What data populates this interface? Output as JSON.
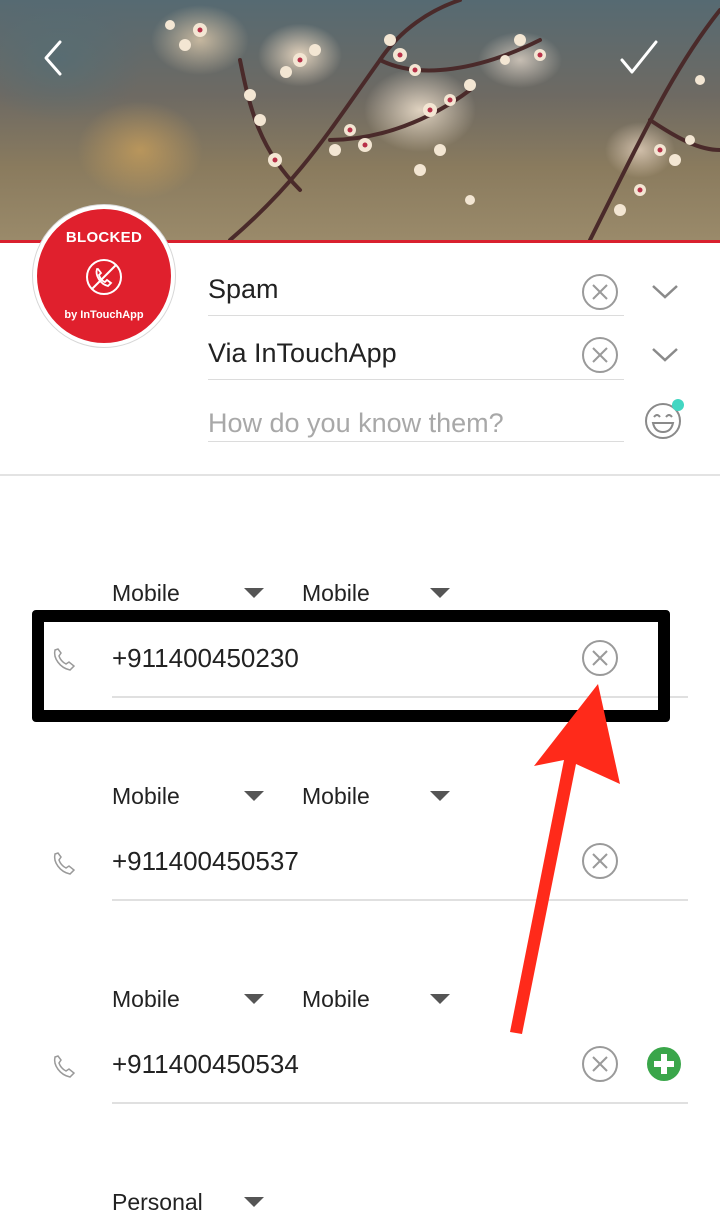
{
  "header": {
    "back_icon": "chevron-left-icon",
    "confirm_icon": "checkmark-icon"
  },
  "avatar": {
    "badge_text": "BLOCKED",
    "brand_text": "by InTouchApp",
    "accent_color": "#e0202d"
  },
  "fields": [
    {
      "value": "Spam",
      "icon": "clear-icon",
      "has_dropdown": true
    },
    {
      "value": "Via InTouchApp",
      "icon": "clear-icon",
      "has_dropdown": true
    }
  ],
  "how_know": {
    "placeholder": "How do you know them?",
    "icon": "emoji-icon"
  },
  "phones": [
    {
      "type1": "Mobile",
      "type2": "Mobile",
      "number": "+911400450230",
      "highlighted": true
    },
    {
      "type1": "Mobile",
      "type2": "Mobile",
      "number": "+911400450537",
      "highlighted": false
    },
    {
      "type1": "Mobile",
      "type2": "Mobile",
      "number": "+911400450534",
      "highlighted": false,
      "add_button": true
    }
  ],
  "next_section": {
    "type_label": "Personal"
  },
  "colors": {
    "brand_red": "#d9202e",
    "add_green": "#3aa64a",
    "notification_dot": "#43d6c2",
    "annotation_arrow": "#ff2a1a"
  }
}
